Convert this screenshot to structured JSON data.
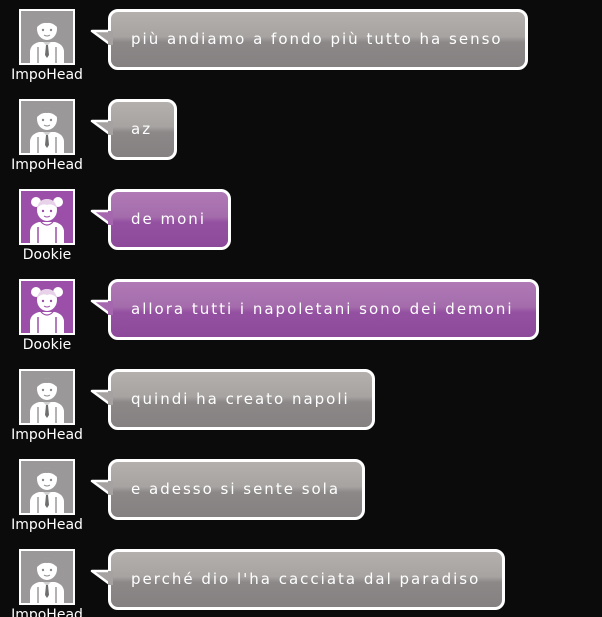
{
  "colors": {
    "background": "#0b0b0b",
    "gray_bubble": "#9e9a99",
    "purple_bubble": "#9c5ca6",
    "border": "#ffffff"
  },
  "messages": [
    {
      "user": "ImpoHead",
      "avatar": "male-avatar-icon",
      "style": "gray",
      "text": "più andiamo a fondo più tutto ha senso"
    },
    {
      "user": "ImpoHead",
      "avatar": "male-avatar-icon",
      "style": "gray",
      "text": "az"
    },
    {
      "user": "Dookie",
      "avatar": "female-avatar-icon",
      "style": "purple",
      "text": "de moni"
    },
    {
      "user": "Dookie",
      "avatar": "female-avatar-icon",
      "style": "purple",
      "text": "allora tutti i napoletani sono dei demoni"
    },
    {
      "user": "ImpoHead",
      "avatar": "male-avatar-icon",
      "style": "gray",
      "text": "quindi ha creato napoli"
    },
    {
      "user": "ImpoHead",
      "avatar": "male-avatar-icon",
      "style": "gray",
      "text": "e adesso si sente sola"
    },
    {
      "user": "ImpoHead",
      "avatar": "male-avatar-icon",
      "style": "gray",
      "text": "perché dio l'ha cacciata dal paradiso"
    }
  ]
}
